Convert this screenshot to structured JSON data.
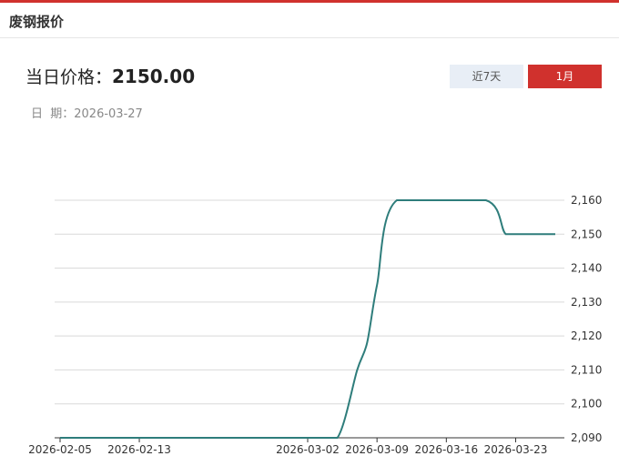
{
  "header": {
    "title": "废钢报价"
  },
  "summary": {
    "price_label": "当日价格：",
    "price_value": "2150.00",
    "date_label": "日  期：",
    "date_value": "2026-03-27"
  },
  "range_buttons": {
    "week_label": "近7天",
    "month_label": "1月",
    "active": "month"
  },
  "colors": {
    "accent": "#d0312d",
    "line": "#2e7d7b",
    "grid": "#d9d9d9"
  },
  "chart_data": {
    "type": "line",
    "x": [
      "2026-02-05",
      "2026-02-13",
      "2026-03-02",
      "2026-03-05",
      "2026-03-07",
      "2026-03-08",
      "2026-03-09",
      "2026-03-11",
      "2026-03-20",
      "2026-03-22",
      "2026-03-24",
      "2026-03-27"
    ],
    "series": [
      {
        "values": [
          2090,
          2090,
          2090,
          2090,
          2110,
          2118,
          2135,
          2160,
          2160,
          2150,
          2150,
          2150
        ]
      }
    ],
    "x_ticks": [
      "2026-02-05",
      "2026-02-13",
      "2026-03-02",
      "2026-03-09",
      "2026-03-16",
      "2026-03-23"
    ],
    "y_ticks": [
      2090,
      2100,
      2110,
      2120,
      2130,
      2140,
      2150,
      2160
    ],
    "y_tick_labels": [
      "2,090",
      "2,100",
      "2,110",
      "2,120",
      "2,130",
      "2,140",
      "2,150",
      "2,160"
    ],
    "ylim": [
      2090,
      2160
    ],
    "grid": true,
    "y_axis_position": "right"
  }
}
